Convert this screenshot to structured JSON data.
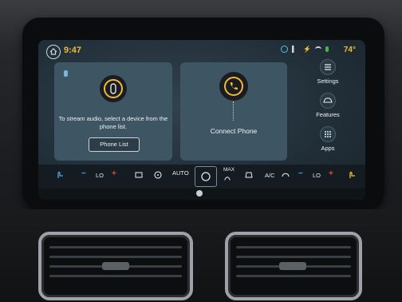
{
  "status_bar": {
    "time": "9:47",
    "outside_temp": "74°"
  },
  "audio_card": {
    "message": "To stream audio, select a device from the phone list.",
    "button_label": "Phone List"
  },
  "phone_card": {
    "label": "Connect Phone"
  },
  "right_menu": {
    "items": [
      {
        "label": "Settings",
        "icon": "sliders-icon"
      },
      {
        "label": "Features",
        "icon": "car-icon"
      },
      {
        "label": "Apps",
        "icon": "apps-grid-icon"
      }
    ]
  },
  "climate_bar": {
    "driver_minus": "−",
    "driver_lo": "LO",
    "driver_plus": "+",
    "auto": "AUTO",
    "max": "MAX",
    "ac": "A/C",
    "passenger_minus": "−",
    "passenger_lo": "LO",
    "passenger_plus": "+"
  },
  "colors": {
    "accent": "#f0b93a",
    "card": "#3e5563",
    "heat": "#e04a3a",
    "cool": "#4da3e0"
  }
}
